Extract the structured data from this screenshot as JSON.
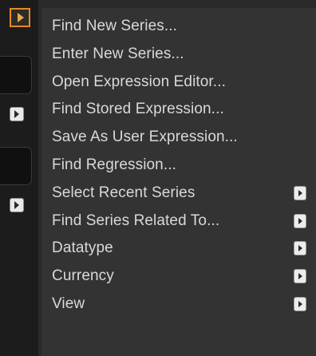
{
  "menu": {
    "items": [
      {
        "label": "Find New Series...",
        "has_submenu": false
      },
      {
        "label": "Enter New Series...",
        "has_submenu": false
      },
      {
        "label": "Open Expression Editor...",
        "has_submenu": false
      },
      {
        "label": "Find Stored Expression...",
        "has_submenu": false
      },
      {
        "label": "Save As User Expression...",
        "has_submenu": false
      },
      {
        "label": "Find Regression...",
        "has_submenu": false
      },
      {
        "label": "Select Recent Series",
        "has_submenu": true,
        "icon": "chevron-right-icon"
      },
      {
        "label": "Find Series Related To...",
        "has_submenu": true,
        "icon": "chevron-right-icon"
      },
      {
        "label": "Datatype",
        "has_submenu": true,
        "icon": "chevron-right-icon"
      },
      {
        "label": "Currency",
        "has_submenu": true,
        "icon": "chevron-right-icon"
      },
      {
        "label": "View",
        "has_submenu": true,
        "icon": "chevron-right-icon"
      }
    ]
  },
  "left_strip": {
    "expand_icon": "orange-play-icon",
    "arrow_icon": "chevron-right-icon"
  },
  "colors": {
    "menu_background": "#333333",
    "menu_text": "#d9d9d9",
    "left_strip_background": "#1c1c1c",
    "accent_orange": "#e88a1e"
  }
}
